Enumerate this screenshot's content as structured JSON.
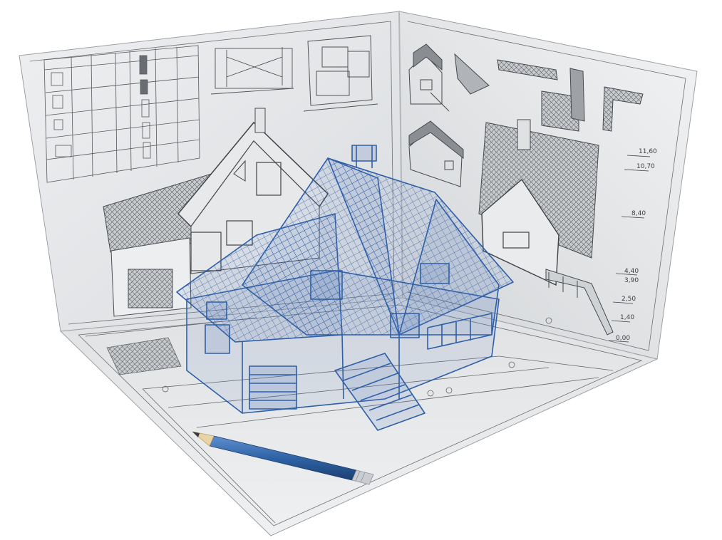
{
  "scene": {
    "description_free": true,
    "elevation_marks": [
      "11,60",
      "10,70",
      "8,40",
      "4,40",
      "3,90",
      "2,50",
      "1,40",
      "0,00"
    ],
    "colors": {
      "paper": "#e4e6e8",
      "paper_shadow": "#cfd2d5",
      "ink": "#4a4d52",
      "blue_model": "#2f5fa8",
      "pencil": "#2e5f9c",
      "pencil_tip": "#e9d4a6"
    }
  }
}
